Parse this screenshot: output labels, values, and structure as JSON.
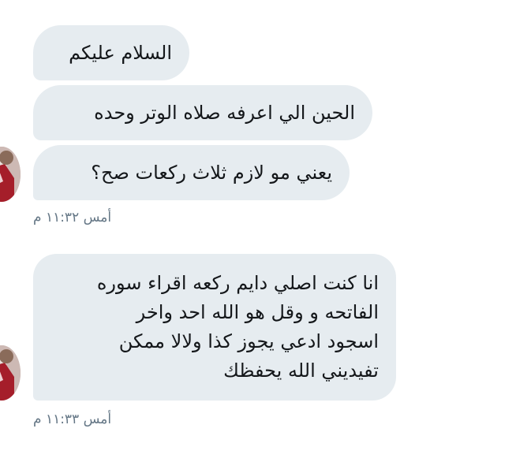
{
  "conversation": {
    "messages_group1": [
      "السلام عليكم",
      "الحين الي اعرفه صلاه الوتر وحده",
      "يعني مو لازم ثلاث ركعات صح؟"
    ],
    "timestamp1": "أمس ١١:٣٢ م",
    "message_group2_lines": [
      "انا كنت اصلي دايم ركعه اقراء سوره",
      "الفاتحه و وقل هو الله احد واخر",
      "اسجود ادعي يجوز كذا ولالا ممكن",
      "تفيديني الله يحفظك"
    ],
    "timestamp2": "أمس ١١:٣٣ م"
  },
  "colors": {
    "bubble_bg": "#e6ecf0",
    "text": "#14171a",
    "timestamp": "#657786"
  }
}
